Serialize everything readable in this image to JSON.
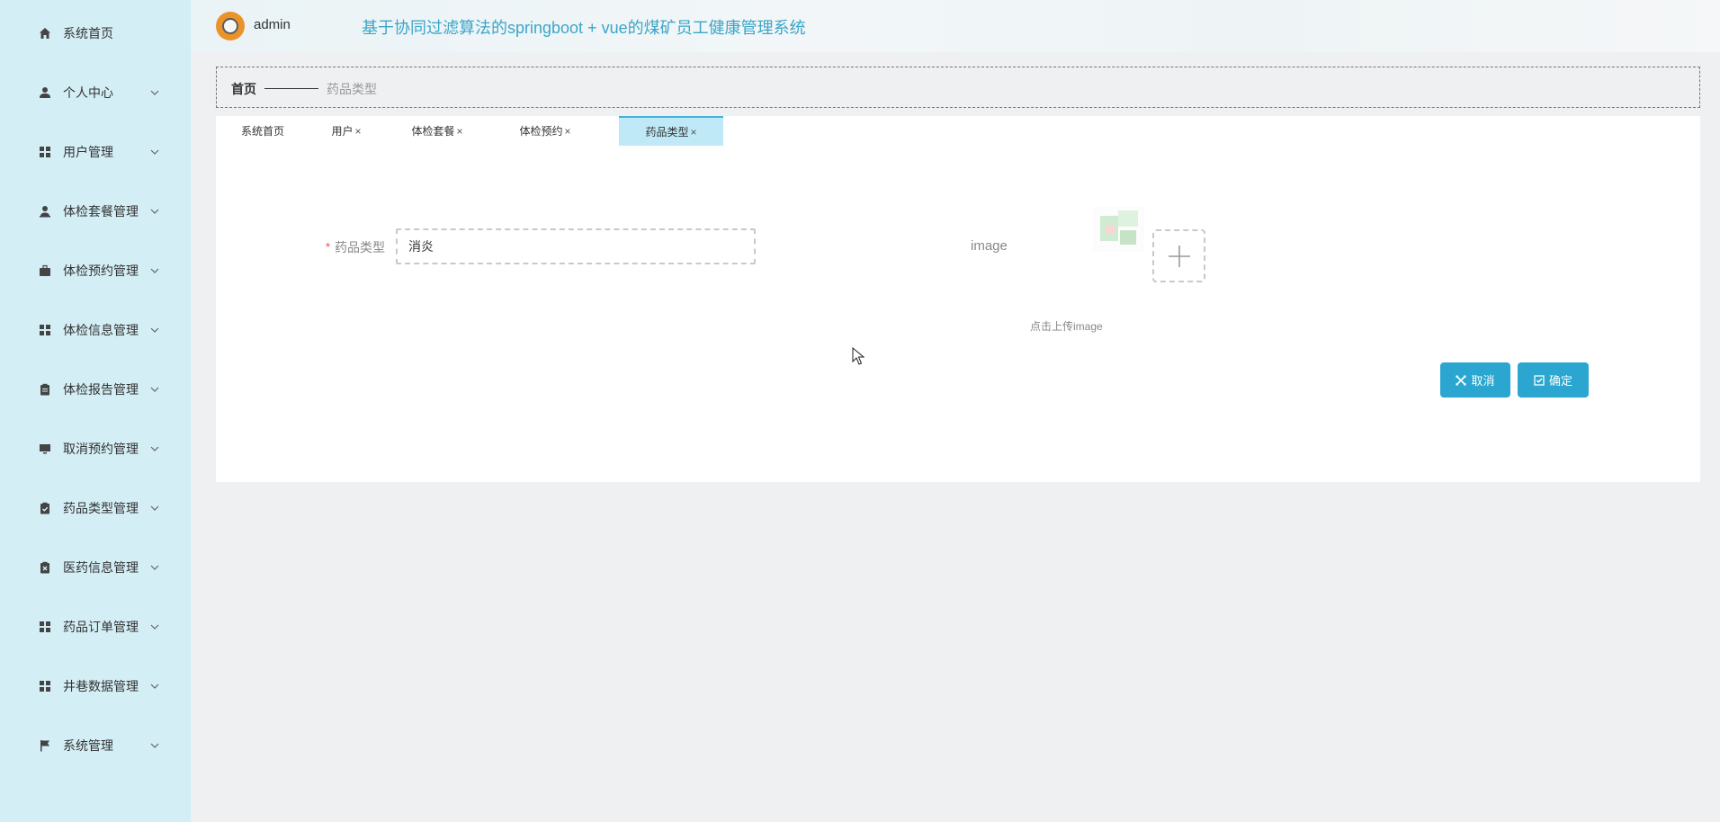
{
  "header": {
    "username": "admin",
    "app_title": "基于协同过滤算法的springboot + vue的煤矿员工健康管理系统"
  },
  "sidebar": {
    "items": [
      {
        "label": "系统首页",
        "icon": "home-icon",
        "has_children": false
      },
      {
        "label": "个人中心",
        "icon": "user-icon",
        "has_children": true
      },
      {
        "label": "用户管理",
        "icon": "grid-icon",
        "has_children": true
      },
      {
        "label": "体检套餐管理",
        "icon": "user-tie-icon",
        "has_children": true
      },
      {
        "label": "体检预约管理",
        "icon": "briefcase-icon",
        "has_children": true
      },
      {
        "label": "体检信息管理",
        "icon": "grid-icon",
        "has_children": true
      },
      {
        "label": "体检报告管理",
        "icon": "clipboard-icon",
        "has_children": true
      },
      {
        "label": "取消预约管理",
        "icon": "monitor-icon",
        "has_children": true
      },
      {
        "label": "药品类型管理",
        "icon": "clipboard-check-icon",
        "has_children": true
      },
      {
        "label": "医药信息管理",
        "icon": "clipboard-x-icon",
        "has_children": true
      },
      {
        "label": "药品订单管理",
        "icon": "grid-icon",
        "has_children": true
      },
      {
        "label": "井巷数据管理",
        "icon": "grid-icon",
        "has_children": true
      },
      {
        "label": "系统管理",
        "icon": "flag-icon",
        "has_children": true
      }
    ]
  },
  "breadcrumb": {
    "home": "首页",
    "current": "药品类型"
  },
  "tabs": [
    {
      "label": "系统首页",
      "closable": false,
      "active": false
    },
    {
      "label": "用户",
      "closable": true,
      "active": false
    },
    {
      "label": "体检套餐",
      "closable": true,
      "active": false
    },
    {
      "label": "体检预约",
      "closable": true,
      "active": false
    },
    {
      "label": "药品类型",
      "closable": true,
      "active": true
    }
  ],
  "tab_close_glyph": "×",
  "form": {
    "required_mark": "*",
    "type_label": "药品类型",
    "type_value": "消炎",
    "image_label": "image",
    "upload_hint": "点击上传image",
    "cancel_label": "取消",
    "confirm_label": "确定"
  },
  "colors": {
    "sidebar_bg": "#d3eef5",
    "accent": "#2aa6d0",
    "title": "#3aa6c8",
    "active_tab": "#bfe9f6"
  }
}
